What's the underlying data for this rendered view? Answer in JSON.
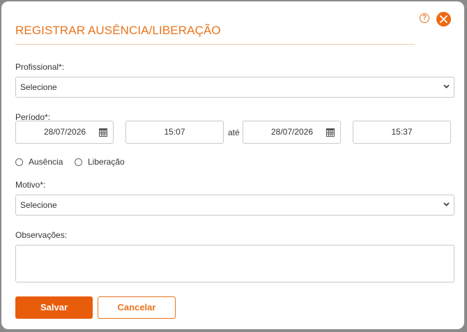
{
  "dialog": {
    "title": "REGISTRAR AUSÊNCIA/LIBERAÇÃO",
    "help_glyph": "?",
    "icons": [
      "help-icon",
      "close-icon"
    ],
    "accent_color": "#e8741c"
  },
  "form": {
    "profissional": {
      "label": "Profissional*:",
      "selected": "Selecione"
    },
    "periodo": {
      "label": "Período*:",
      "start_date": "28/07/2026",
      "start_time": "15:07",
      "separator": "até",
      "end_date": "28/07/2026",
      "end_time": "15:37"
    },
    "tipo": {
      "options": [
        "Ausência",
        "Liberação"
      ]
    },
    "motivo": {
      "label": "Motivo*:",
      "selected": "Selecione"
    },
    "observacoes": {
      "label": "Observações:",
      "value": ""
    }
  },
  "buttons": {
    "save": "Salvar",
    "cancel": "Cancelar"
  }
}
